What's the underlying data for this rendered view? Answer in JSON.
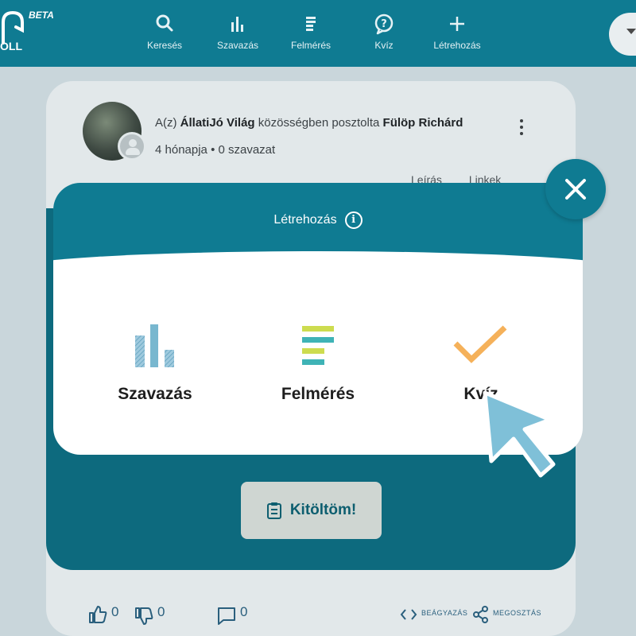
{
  "topnav": {
    "logo_text": "OLL",
    "beta_badge": "BETA",
    "items": [
      {
        "label": "Keresés",
        "icon": "search-icon"
      },
      {
        "label": "Szavazás",
        "icon": "bar-chart-icon"
      },
      {
        "label": "Felmérés",
        "icon": "survey-icon"
      },
      {
        "label": "Kvíz",
        "icon": "question-bubble-icon"
      },
      {
        "label": "Létrehozás",
        "icon": "plus-icon"
      }
    ]
  },
  "post": {
    "prefix": "A(z) ",
    "community": "ÁllatiJó Világ",
    "middle": " közösségben posztolta ",
    "author": "Fülöp Richárd",
    "meta": "4 hónapja • 0 szavazat",
    "tabs": [
      "Leírás",
      "Linkek"
    ],
    "fill_button": "Kitöltöm!",
    "likes": "0",
    "dislikes": "0",
    "comments": "0",
    "embed_label": "BEÁGYAZÁS",
    "share_label": "MEGOSZTÁS"
  },
  "modal": {
    "title": "Létrehozás",
    "info_symbol": "i",
    "options": [
      {
        "label": "Szavazás",
        "icon": "bar-chart-icon"
      },
      {
        "label": "Felmérés",
        "icon": "survey-lines-icon"
      },
      {
        "label": "Kvíz",
        "icon": "checkmark-icon"
      }
    ]
  },
  "colors": {
    "brand_teal": "#0f7b92",
    "chart_blue": "#78b7cf",
    "survey_lime": "#cddc4f",
    "survey_teal": "#3fb3b6",
    "quiz_orange": "#f5b15a",
    "cursor_blue": "#7fc0d8"
  }
}
